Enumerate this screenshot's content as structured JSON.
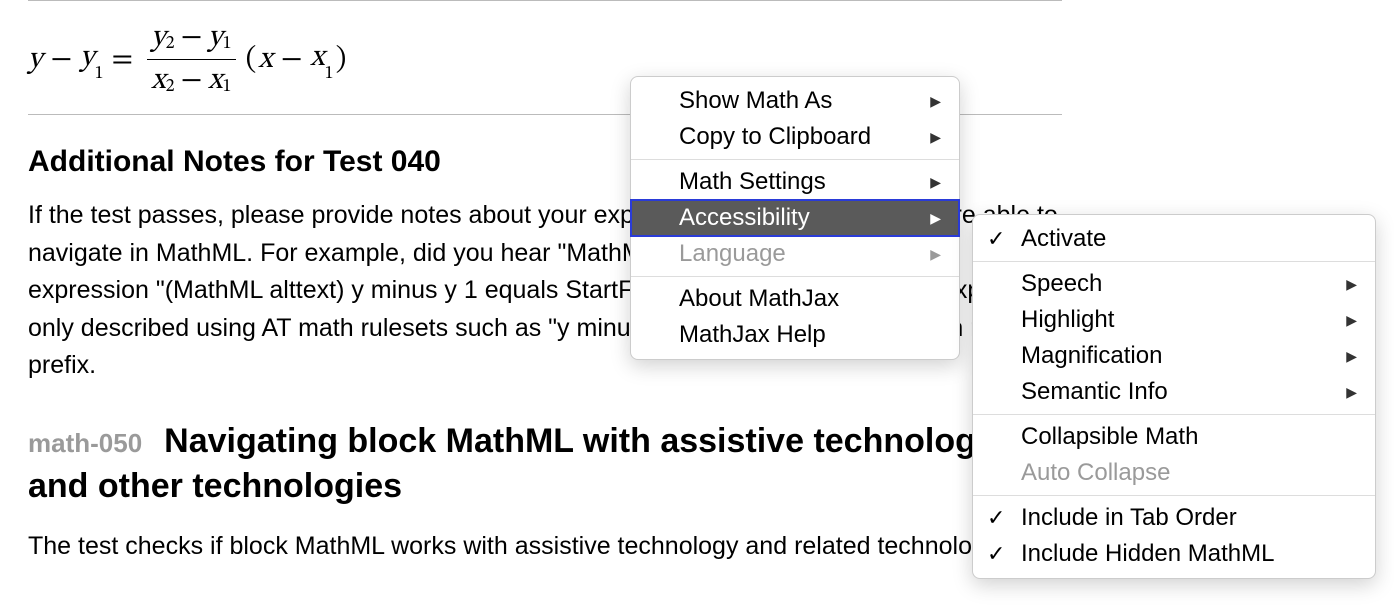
{
  "math": {
    "lhs_y": "y",
    "minus": "−",
    "y1_var": "y",
    "y1_sub": "1",
    "eq": "=",
    "num_y2_var": "y",
    "num_y2_sub": "2",
    "num_minus": "−",
    "num_y1_var": "y",
    "num_y1_sub": "1",
    "den_x2_var": "x",
    "den_x2_sub": "2",
    "den_minus": "−",
    "den_x1_var": "x",
    "den_x1_sub": "1",
    "lparen": "(",
    "rhs_x": "x",
    "rhs_minus": "−",
    "rhs_x1_var": "x",
    "rhs_x1_sub": "1",
    "rparen": ")"
  },
  "notes_heading": "Additional Notes for Test 040",
  "notes_body": "If the test passes, please provide notes about your experience and how well you were able to navigate in MathML. For example, did you hear \"MathML alttext\" and you heard the expression \"(MathML alttext) y minus y 1 equals StartFraction …\" or was the math expression only described using AT math rulesets such as \"y minus y subscript 1 equals …\" with no prefix.",
  "test": {
    "id": "math-050",
    "title": "Navigating block MathML with assistive technology and other technologies"
  },
  "test_body": "The test checks if block MathML works with assistive technology and related technologies.",
  "menu_main": {
    "items": [
      {
        "label": "Show Math As",
        "submenu": true
      },
      {
        "label": "Copy to Clipboard",
        "submenu": true
      },
      {
        "sep": true
      },
      {
        "label": "Math Settings",
        "submenu": true
      },
      {
        "label": "Accessibility",
        "submenu": true,
        "selected": true
      },
      {
        "label": "Language",
        "submenu": true,
        "disabled": true
      },
      {
        "sep": true
      },
      {
        "label": "About MathJax"
      },
      {
        "label": "MathJax Help"
      }
    ]
  },
  "menu_sub": {
    "items": [
      {
        "label": "Activate",
        "checked": true
      },
      {
        "sep": true
      },
      {
        "label": "Speech",
        "submenu": true
      },
      {
        "label": "Highlight",
        "submenu": true
      },
      {
        "label": "Magnification",
        "submenu": true
      },
      {
        "label": "Semantic Info",
        "submenu": true
      },
      {
        "sep": true
      },
      {
        "label": "Collapsible Math"
      },
      {
        "label": "Auto Collapse",
        "disabled": true
      },
      {
        "sep": true
      },
      {
        "label": "Include in Tab Order",
        "checked": true
      },
      {
        "label": "Include Hidden MathML",
        "checked": true
      }
    ]
  }
}
